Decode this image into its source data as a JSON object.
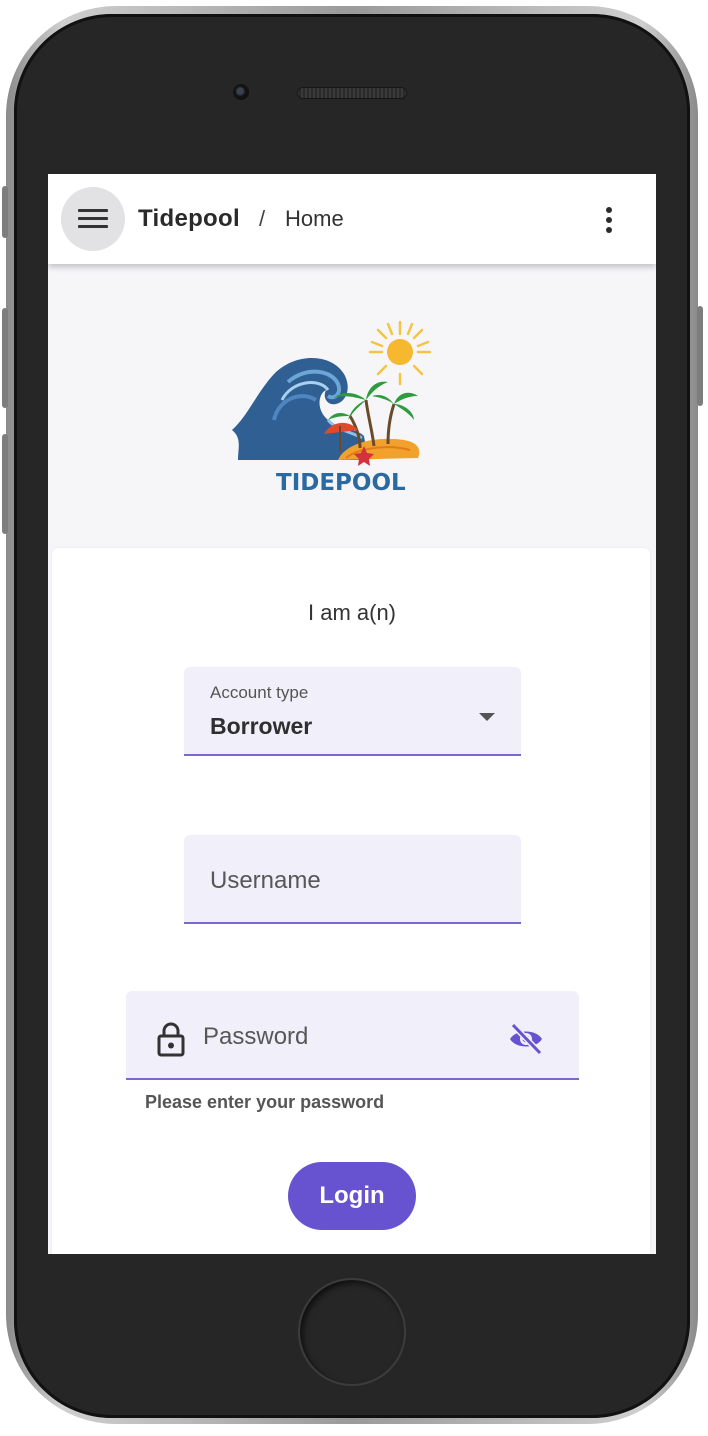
{
  "app_bar": {
    "menu_icon": "menu-icon",
    "brand": "Tidepool",
    "separator": "/",
    "page": "Home",
    "more_icon": "more-vert-icon"
  },
  "logo": {
    "wordmark": "TIDEPOOL"
  },
  "form": {
    "prompt": "I am a(n)",
    "account_type": {
      "label": "Account type",
      "value": "Borrower",
      "icon": "dropdown-arrow-icon"
    },
    "username": {
      "placeholder": "Username"
    },
    "password": {
      "placeholder": "Password",
      "lock_icon": "lock-icon",
      "visibility_icon": "visibility-off-icon",
      "helper": "Please enter your password"
    },
    "login_label": "Login"
  },
  "colors": {
    "accent": "#6752cf",
    "field_bg": "#f1eff9",
    "field_underline": "#7b68c9",
    "frame": "#262626"
  }
}
